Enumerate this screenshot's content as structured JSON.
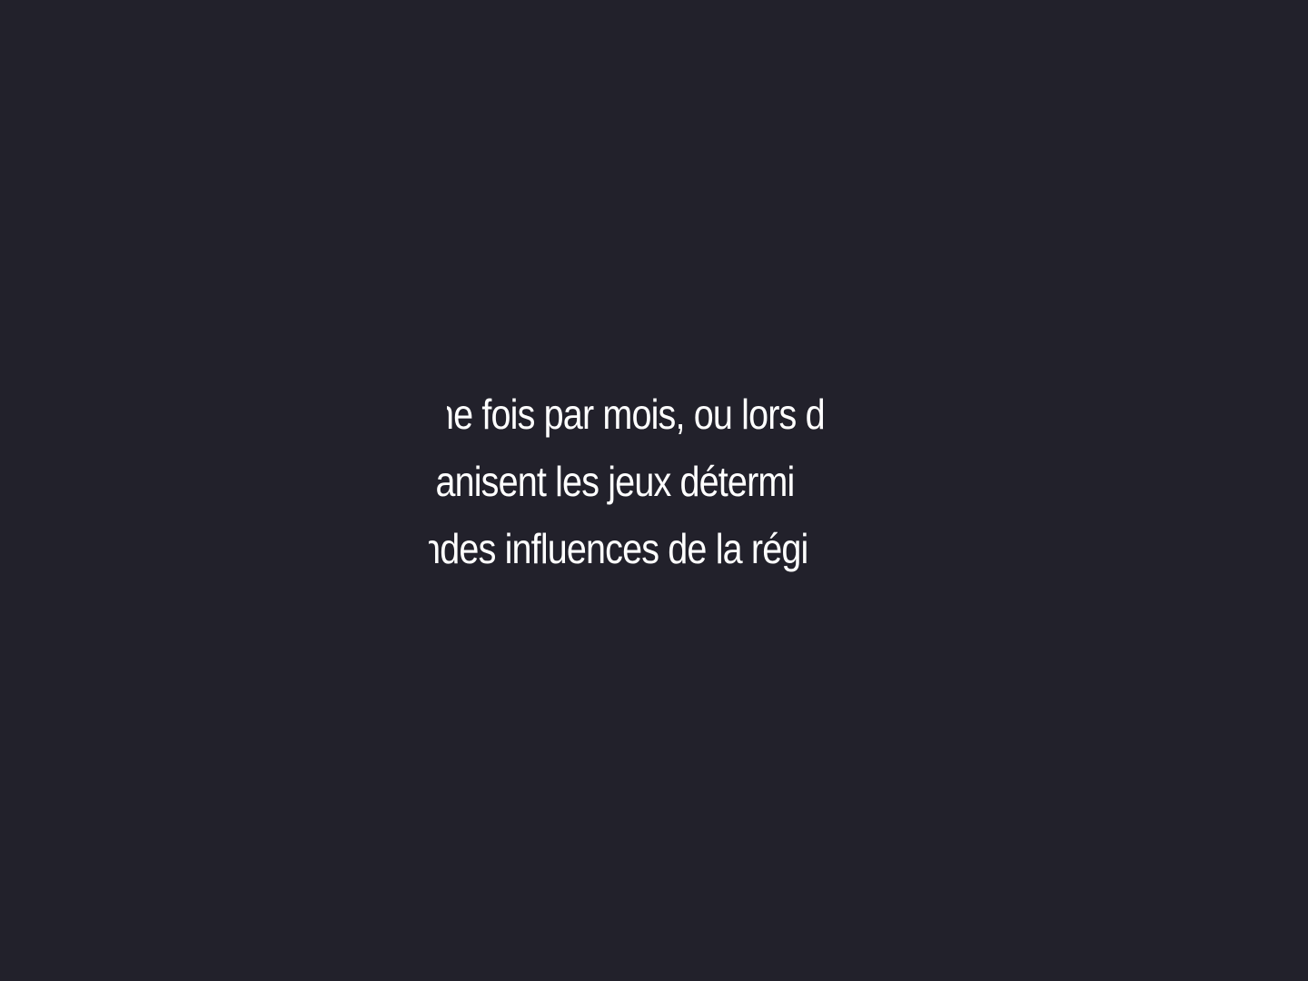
{
  "subtitle": {
    "lines": [
      "ne fois par mois, ou lors d",
      "rganisent les jeux détermi",
      "andes influences de la régi"
    ]
  },
  "colors": {
    "background": "#22212b",
    "text": "#ffffff"
  }
}
